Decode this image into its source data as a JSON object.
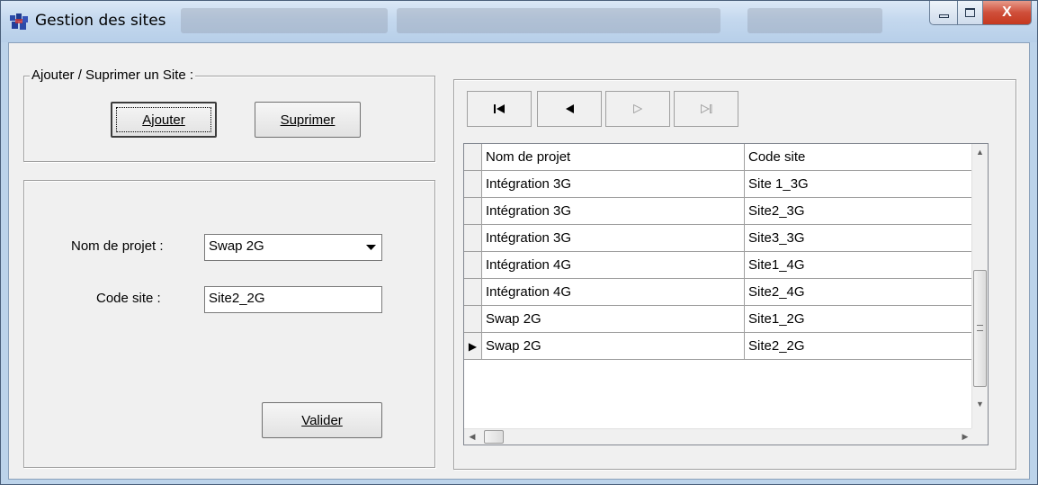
{
  "window": {
    "title": "Gestion des sites",
    "caption": {
      "minimize": "▭",
      "maximize": "□",
      "close": "X"
    }
  },
  "group_add_remove": {
    "legend": "Ajouter / Suprimer un Site  :",
    "add_label": "Ajouter",
    "remove_label": "Suprimer"
  },
  "form": {
    "project_label": "Nom de projet :",
    "project_value": "Swap 2G",
    "site_label": "Code site :",
    "site_value": "Site2_2G",
    "validate_label": "Valider"
  },
  "navigator": {
    "first": "|◀",
    "prev": "◀",
    "next": "▷",
    "last": "▷|"
  },
  "grid": {
    "columns": [
      "Nom de projet",
      "Code site"
    ],
    "rows": [
      {
        "project": "Intégration 3G",
        "site": "Site 1_3G",
        "current": false
      },
      {
        "project": "Intégration 3G",
        "site": "Site2_3G",
        "current": false
      },
      {
        "project": "Intégration 3G",
        "site": "Site3_3G",
        "current": false
      },
      {
        "project": "Intégration 4G",
        "site": "Site1_4G",
        "current": false
      },
      {
        "project": "Intégration 4G",
        "site": "Site2_4G",
        "current": false
      },
      {
        "project": "Swap 2G",
        "site": "Site1_2G",
        "current": false
      },
      {
        "project": "Swap 2G",
        "site": "Site2_2G",
        "current": true
      }
    ],
    "current_marker": "▶"
  }
}
